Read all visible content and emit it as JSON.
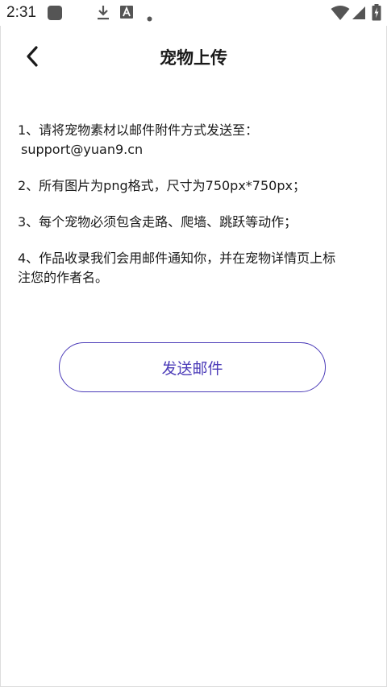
{
  "status_bar": {
    "time": "2:31",
    "icons": [
      "app-square-icon",
      "download-icon",
      "font-a-icon",
      "dot-icon",
      "wifi-icon",
      "signal-icon",
      "battery-charging-icon"
    ]
  },
  "header": {
    "title": "宠物上传",
    "back_icon": "chevron-left-icon"
  },
  "instructions": {
    "item1_line1": "1、请将宠物素材以邮件附件方式发送至：",
    "item1_email": "support@yuan9.cn",
    "item2": "2、所有图片为png格式，尺寸为750px*750px；",
    "item3": "3、每个宠物必须包含走路、爬墙、跳跃等动作；",
    "item4_line1": "4、作品收录我们会用邮件通知你，并在宠物详情页上标",
    "item4_line2": "注您的作者名。"
  },
  "actions": {
    "send_email_label": "发送邮件"
  },
  "colors": {
    "accent": "#4b3bb8",
    "text": "#1a1a1a",
    "background": "#ffffff"
  }
}
